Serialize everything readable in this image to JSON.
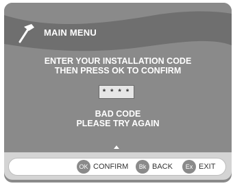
{
  "header": {
    "title": "MAIN MENU",
    "icon": "tools-icon"
  },
  "prompt": {
    "line1": "ENTER YOUR INSTALLATION CODE",
    "line2": "THEN PRESS OK TO CONFIRM"
  },
  "code_input": {
    "value": "* * * *"
  },
  "error": {
    "line1": "BAD CODE",
    "line2": "PLEASE TRY AGAIN"
  },
  "footer": {
    "buttons": [
      {
        "badge": "OK",
        "label": "CONFIRM"
      },
      {
        "badge": "Bk",
        "label": "BACK"
      },
      {
        "badge": "Ex",
        "label": "EXIT"
      }
    ]
  },
  "colors": {
    "screen_bg": "#8a8a8a",
    "header_wave": "#6f6f6f",
    "text": "#ffffff",
    "footer_bg": "#d4d4d4"
  }
}
